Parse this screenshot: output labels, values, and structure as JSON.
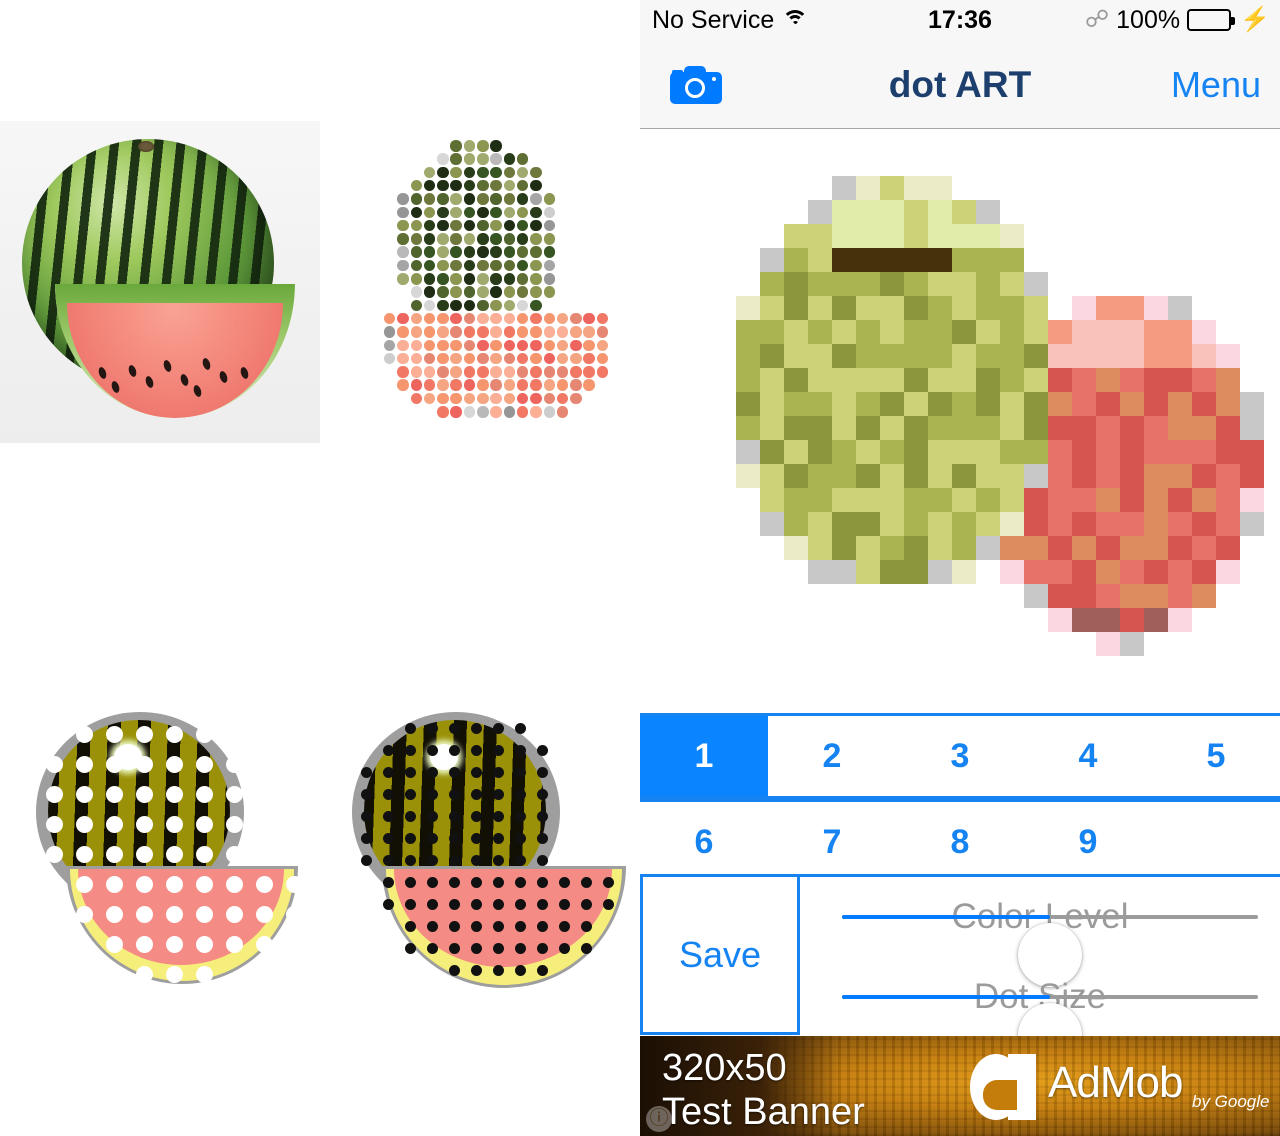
{
  "app": {
    "title": "dot ART"
  },
  "status_bar": {
    "carrier": "No Service",
    "wifi_icon": "wifi-icon",
    "time": "17:36",
    "bluetooth_icon": "bluetooth-icon",
    "battery_percent": "100%",
    "battery_icon": "battery-icon",
    "charging_icon": "lightning-bolt-icon"
  },
  "nav_bar": {
    "camera_icon": "camera-icon",
    "title": "dot ART",
    "menu_label": "Menu",
    "title_color": "#1d3f6e",
    "accent_color": "#1583f2"
  },
  "segmented_control": {
    "selected": "1",
    "options": [
      "1",
      "2",
      "3",
      "4",
      "5",
      "6",
      "7",
      "8",
      "9"
    ],
    "row1": [
      "1",
      "2",
      "3",
      "4",
      "5"
    ],
    "row2": [
      "6",
      "7",
      "8",
      "9"
    ],
    "selected_bg": "#0a84ff",
    "selected_fg": "#ffffff",
    "border_color": "#1583f2"
  },
  "controls": {
    "save_label": "Save",
    "sliders": [
      {
        "label": "Color Level",
        "value_percent": 50
      },
      {
        "label": "Dot Size",
        "value_percent": 50
      }
    ],
    "slider_fill_color": "#007aff",
    "slider_track_color": "#9b9b9b"
  },
  "ad_banner": {
    "line1": "320x50",
    "line2": "Test Banner",
    "brand": "AdMob",
    "byline": "by Google",
    "info_icon": "info-icon"
  },
  "left_gallery": {
    "items": [
      {
        "name": "original-photo",
        "caption": "watermelon whole and slice photo"
      },
      {
        "name": "dot-art-preview",
        "caption": "halftone dot grid rendering of watermelon"
      },
      {
        "name": "halftone-white-dots",
        "caption": "posterized watermelon with white dot overlay"
      },
      {
        "name": "halftone-black-dots",
        "caption": "posterized watermelon with black dot overlay"
      }
    ]
  },
  "canvas": {
    "artwork_name": "pixelated-apples",
    "caption": "mosaic pixel rendering of a green apple and a red apple"
  }
}
